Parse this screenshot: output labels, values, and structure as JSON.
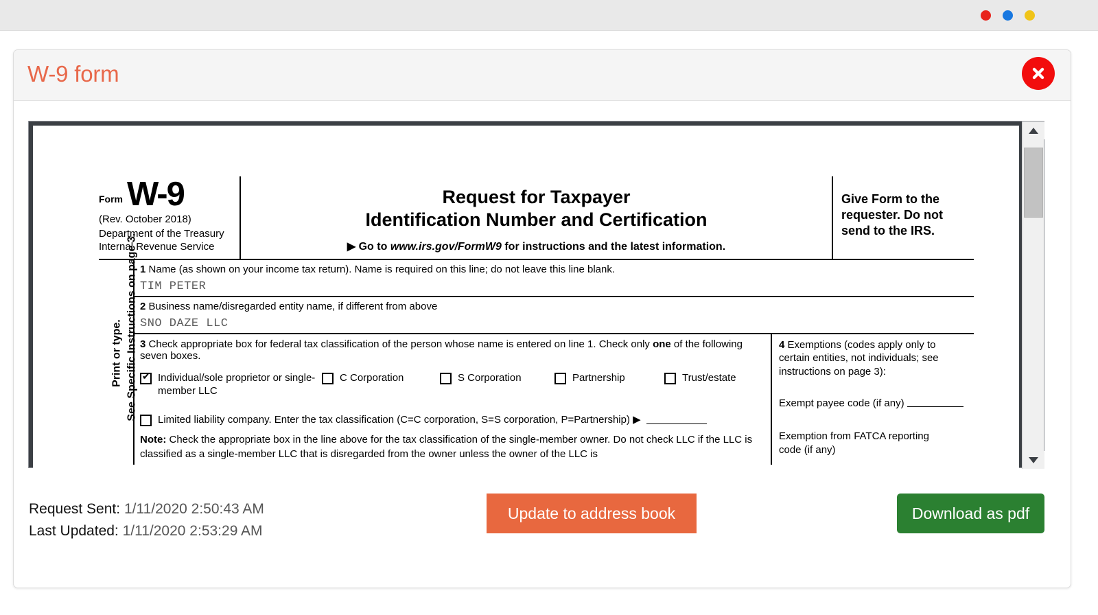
{
  "window_controls": [
    {
      "name": "close-dot",
      "color": "#e8241c"
    },
    {
      "name": "minimize-dot",
      "color": "#1878e0"
    },
    {
      "name": "maximize-dot",
      "color": "#f0c419"
    }
  ],
  "modal": {
    "title": "W-9 form",
    "title_color": "#e8684a",
    "close_label": "×"
  },
  "document": {
    "header": {
      "form_word": "Form",
      "form_number": "W-9",
      "revision": "(Rev. October 2018)",
      "department_line1": "Department of the Treasury",
      "department_line2": "Internal Revenue Service",
      "title_line1": "Request for Taxpayer",
      "title_line2": "Identification Number and Certification",
      "goto_prefix": "▶ Go to ",
      "goto_url": "www.irs.gov/FormW9",
      "goto_suffix": " for instructions and the latest information.",
      "give_form_note": "Give Form to the requester. Do not send to the IRS."
    },
    "side_note_line1": "Print or type.",
    "side_note_line2": "See Specific Instructions on page 3.",
    "line1": {
      "number": "1",
      "label": "Name (as shown on your income tax return). Name is required on this line; do not leave this line blank.",
      "value": "TIM  PETER"
    },
    "line2": {
      "number": "2",
      "label": "Business name/disregarded entity name, if different from above",
      "value": "SNO DAZE LLC"
    },
    "line3": {
      "number": "3",
      "label_a": "Check appropriate box for federal tax classification of the person whose name is entered on line 1. Check only ",
      "label_bold": "one",
      "label_b": " of the following seven boxes.",
      "checkboxes": [
        {
          "label": "Individual/sole proprietor or single-member LLC",
          "checked": true
        },
        {
          "label": "C Corporation",
          "checked": false
        },
        {
          "label": "S Corporation",
          "checked": false
        },
        {
          "label": "Partnership",
          "checked": false
        },
        {
          "label": "Trust/estate",
          "checked": false
        }
      ],
      "llc_checkbox": {
        "label": "Limited liability company. Enter the tax classification (C=C corporation, S=S corporation, P=Partnership) ▶",
        "checked": false,
        "value": ""
      },
      "note_bold": "Note:",
      "note_text": " Check the appropriate box in the line above for the tax classification of the single-member owner.  Do not check LLC if the LLC is classified as a single-member LLC that is disregarded from the owner unless the owner of the LLC is"
    },
    "line4": {
      "number": "4",
      "label": "Exemptions (codes apply only to certain entities, not individuals; see instructions on page 3):",
      "exempt_payee_label": "Exempt payee code (if any)",
      "exempt_payee_value": "",
      "fatca_label_line1": "Exemption from FATCA reporting",
      "fatca_label_line2": "code (if any)",
      "fatca_value": ""
    }
  },
  "footer": {
    "request_sent_label": "Request Sent:",
    "request_sent_value": "1/11/2020 2:50:43 AM",
    "last_updated_label": "Last Updated:",
    "last_updated_value": "1/11/2020 2:53:29 AM",
    "update_button": "Update to address book",
    "update_button_color": "#e8683f",
    "download_button": "Download as pdf",
    "download_button_color": "#2b8031"
  }
}
